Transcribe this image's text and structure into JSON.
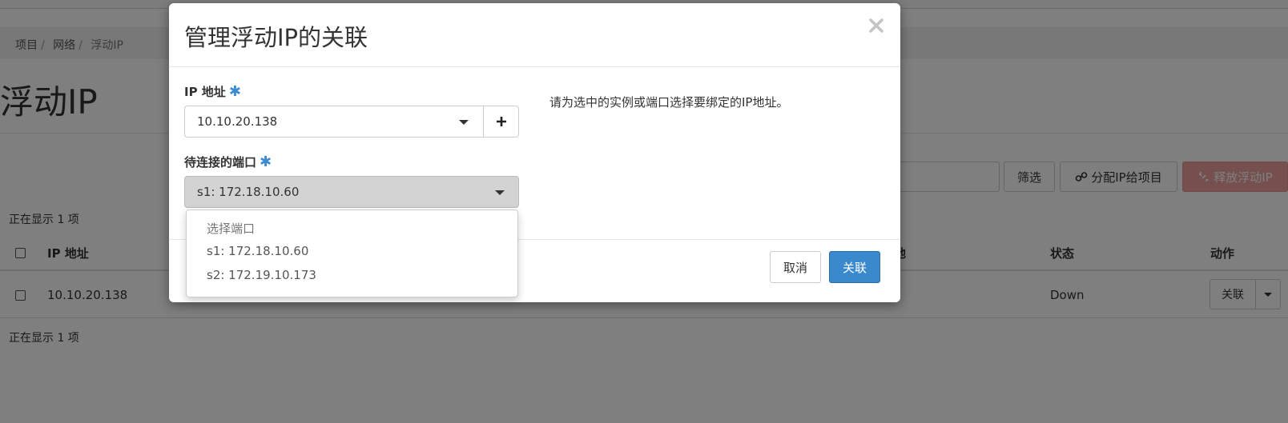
{
  "breadcrumb": [
    {
      "label": "项目"
    },
    {
      "label": "网络"
    },
    {
      "label": "浮动IP"
    }
  ],
  "breadcrumb_separator": "/",
  "page": {
    "title": "浮动IP"
  },
  "toolbar": {
    "filter_label": "筛选",
    "allocate_label": "分配IP给项目",
    "release_label": "释放浮动IP"
  },
  "table": {
    "count_text_top": "正在显示 1 项",
    "count_text_bottom": "正在显示 1 项",
    "headers": {
      "ip_address": "IP 地址",
      "partial_col": "地",
      "status": "状态",
      "actions": "动作"
    },
    "rows": [
      {
        "ip_address": "10.10.20.138",
        "status": "Down",
        "action_label": "关联"
      }
    ]
  },
  "modal": {
    "title": "管理浮动IP的关联",
    "ip_label": "IP 地址",
    "ip_value": "10.10.20.138",
    "port_label": "待连接的端口",
    "port_value": "s1: 172.18.10.60",
    "required_mark": "✱",
    "port_options": [
      {
        "label": "选择端口"
      },
      {
        "label": "s1: 172.18.10.60"
      },
      {
        "label": "s2: 172.19.10.173"
      }
    ],
    "help_text": "请为选中的实例或端口选择要绑定的IP地址。",
    "cancel_label": "取消",
    "associate_label": "关联"
  },
  "colors": {
    "primary": "#3a89cd",
    "danger": "#d9534f",
    "required": "#3b8bd0"
  }
}
